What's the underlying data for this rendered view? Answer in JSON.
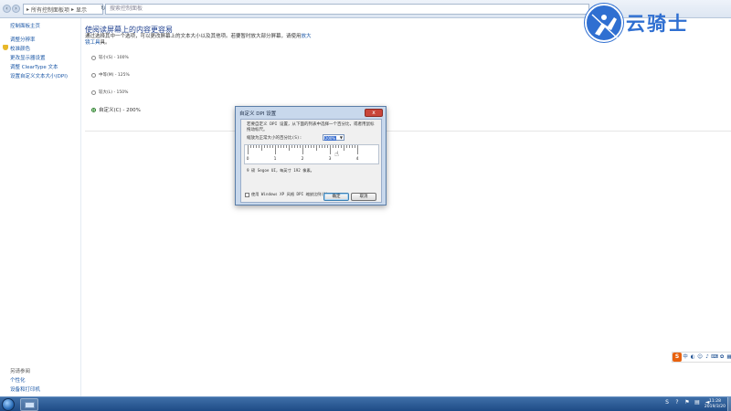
{
  "address": {
    "crumbs": [
      "所有控制面板项",
      "显示"
    ],
    "search_placeholder": "搜索控制面板"
  },
  "sidebar": {
    "home": "控制面板主页",
    "items": [
      "调整分辨率",
      "校准颜色",
      "更改显示器设置",
      "调整 ClearType 文本",
      "设置自定义文本大小(DPI)"
    ],
    "see_also_title": "另请参阅",
    "see_also": [
      "个性化",
      "设备和打印机"
    ]
  },
  "main": {
    "title": "使阅读屏幕上的内容更容易",
    "desc": "通过选择其中一个选项，可以更改屏幕上的文本大小以及其他项。若要暂时放大部分屏幕，请使用",
    "desc_link": "放大镜工具",
    "desc_end": "具。",
    "options": [
      {
        "label": "较小(S) - 100%",
        "selected": false
      },
      {
        "label": "中等(M) - 125%",
        "selected": false
      },
      {
        "label": "较大(L) - 150%",
        "selected": false
      },
      {
        "label": "自定义(C) - 200%",
        "selected": true
      }
    ]
  },
  "dialog": {
    "title": "自定义 DPI 设置",
    "close": "x",
    "instruction": "若要自定义 DPI 设置，从下面的列表中选择一个百分比，或者用鼠标拖动标尺。",
    "scale_label": "缩放为正常大小的百分比(S):",
    "scale_value": "200%",
    "ruler_numbers": [
      "0",
      "1",
      "2",
      "3",
      "4"
    ],
    "sample_text": "9 磅 Segoe UI，每英寸 192 像素。",
    "checkbox_label": "使用 Windows XP 风格 DPI 缩放比例(U)",
    "ok": "确定",
    "cancel": "取消"
  },
  "taskbar": {
    "time": "11:28",
    "date": "2019/3/20"
  },
  "watermark": {
    "text": "云骑士"
  }
}
